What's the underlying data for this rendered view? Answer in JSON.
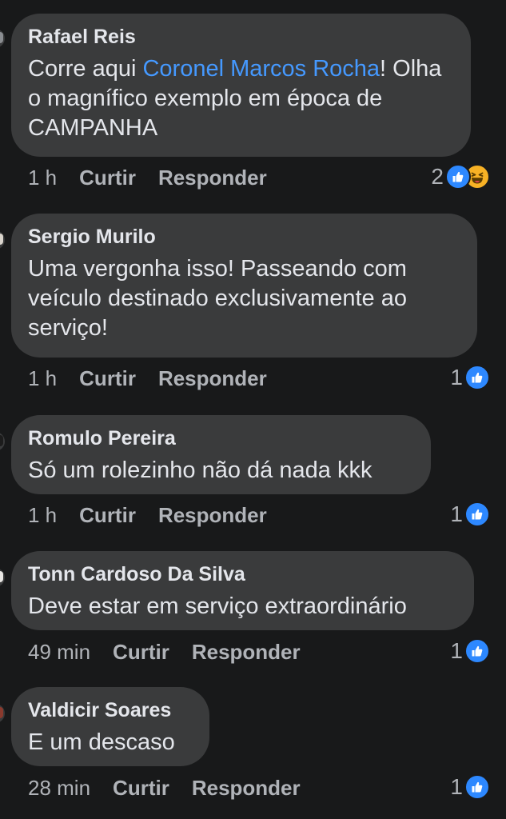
{
  "colors": {
    "background": "#18191a",
    "bubble": "#3a3b3c",
    "text": "#e4e6eb",
    "secondary_text": "#b0b3b8",
    "mention": "#4599ff",
    "like": "#2d88ff",
    "haha": "#f7b125"
  },
  "actions": {
    "like_label": "Curtir",
    "reply_label": "Responder"
  },
  "comments": [
    {
      "author": "Rafael Reis",
      "text_before": "Corre aqui ",
      "mention": "Coronel Marcos Rocha",
      "text_after": "! Olha o magnífico exemplo em época de CAMPANHA",
      "time": "1 h",
      "reaction_count": "2",
      "reaction_icons": [
        "like-icon",
        "haha-icon"
      ]
    },
    {
      "author": "Sergio Murilo",
      "text": "Uma vergonha isso!  Passeando com veículo destinado exclusivamente ao serviço!",
      "time": "1 h",
      "reaction_count": "1",
      "reaction_icons": [
        "like-icon"
      ]
    },
    {
      "author": "Romulo Pereira",
      "text": "Só um rolezinho não dá nada kkk",
      "time": "1 h",
      "reaction_count": "1",
      "reaction_icons": [
        "like-icon"
      ]
    },
    {
      "author": "Tonn Cardoso Da Silva",
      "text": "Deve estar em serviço extraordinário",
      "time": "49 min",
      "reaction_count": "1",
      "reaction_icons": [
        "like-icon"
      ]
    },
    {
      "author": "Valdicir Soares",
      "text": "E um descaso",
      "time": "28 min",
      "reaction_count": "1",
      "reaction_icons": [
        "like-icon"
      ]
    }
  ]
}
